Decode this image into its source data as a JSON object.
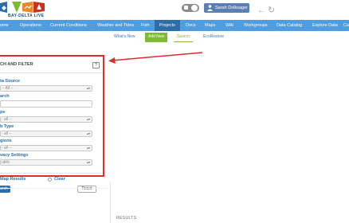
{
  "app": {
    "logo_text": "BAY-DELTA LIVE",
    "logo_colors": [
      "#2e6ea8",
      "#7dbb33",
      "#e8892b",
      "#c8321f"
    ]
  },
  "header": {
    "user_name": "Sarah Dolksager",
    "lock_icon": "lock-icon",
    "user_icon": "person-icon",
    "back_icon": "back-arrow-icon",
    "refresh_icon": "refresh-icon"
  },
  "navbar": {
    "items": [
      "ome",
      "Operations",
      "Current Conditions",
      "Weather and Tides",
      "Fish",
      "Projects",
      "Docs",
      "Maps",
      "Wiki",
      "Workgroups",
      "Data Catalog",
      "Explore Data",
      "Ca"
    ],
    "active": "Projects"
  },
  "subnav": {
    "items": [
      "What's New",
      "Add New",
      "Search",
      "EcoRestore"
    ],
    "highlighted": "Add New",
    "active": "Search"
  },
  "filter_panel": {
    "title": "CH AND FILTER",
    "help_label": "?",
    "fields": [
      {
        "label": "ta Source",
        "value": "-- All --"
      },
      {
        "label": "arch",
        "value": ""
      },
      {
        "label": "pe",
        "value": "- all --"
      },
      {
        "label": "b Type",
        "value": "- all --"
      },
      {
        "label": "gions",
        "value": "- all --"
      },
      {
        "label": "vacy Settings",
        "value": "ublic"
      }
    ],
    "map_results_label": "Map Results",
    "clear_label": "Clear",
    "search_button": "arch",
    "reset_button": "Reset"
  },
  "results": {
    "heading": "RESULTS"
  },
  "annotation": {
    "color": "#e02b2b"
  }
}
